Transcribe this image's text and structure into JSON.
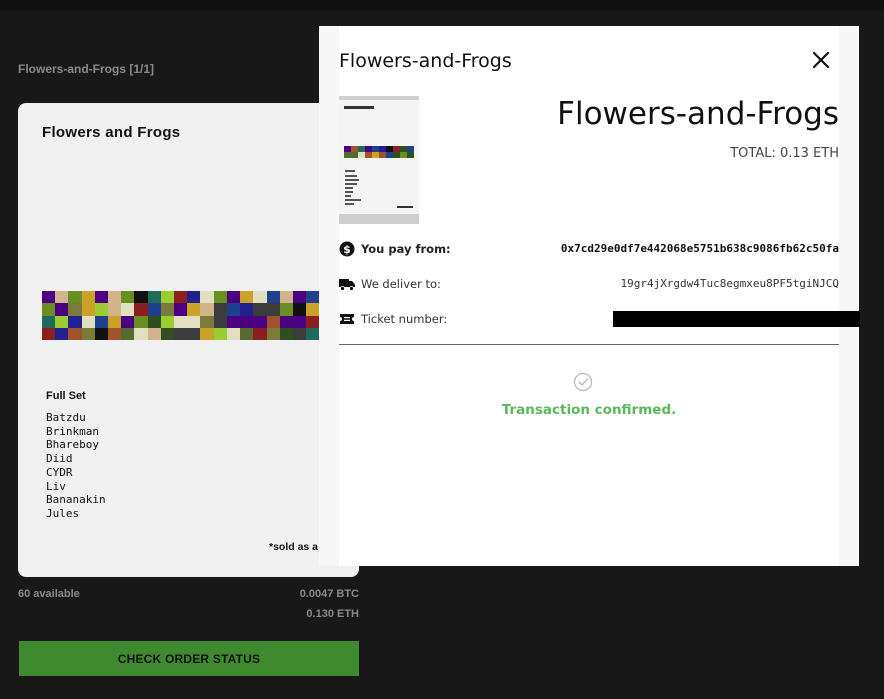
{
  "background": {
    "page_title": "Flowers-and-Frogs [1/1]",
    "card": {
      "artwork_title": "Flowers and Frogs",
      "set_title": "Full Set",
      "members": [
        "Batzdu",
        "Brinkman",
        "Bhareboy",
        "Diid",
        "CYDR",
        "Liv",
        "Bananakin",
        "Jules"
      ],
      "sold_note": "*sold as a"
    },
    "availability": "60 available",
    "price_btc": "0.0047 BTC",
    "price_eth": "0.130 ETH",
    "order_status_button": "CHECK ORDER STATUS"
  },
  "modal": {
    "title": "Flowers-and-Frogs",
    "product_name": "Flowers-and-Frogs",
    "total": "TOTAL: 0.13 ETH",
    "pay_from_label": "You pay from:",
    "pay_from_value": "0x7cd29e0df7e442068e5751b638c9086fb62c50fa",
    "deliver_to_label": "We deliver to:",
    "deliver_to_value": "19gr4jXrgdw4Tuc8egmxeu8PF5tgiNJCQ",
    "ticket_label": "Ticket number:",
    "status_message": "Transaction confirmed."
  },
  "colors": {
    "page_background": "#181818",
    "button_green": "#3f8a2f",
    "confirm_green": "#5cb85c",
    "modal_background": "#ffffff"
  },
  "icons": [
    "dollar-circle-icon",
    "delivery-truck-icon",
    "ticket-icon",
    "close-icon",
    "check-circle-icon"
  ]
}
